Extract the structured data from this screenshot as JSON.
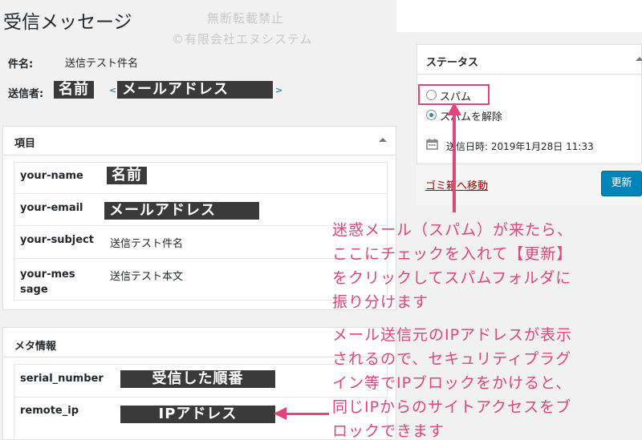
{
  "page": {
    "title": "受信メッセージ",
    "watermark_line1": "無断転載禁止",
    "watermark_line2": "©有限会社エヌシステム"
  },
  "header": {
    "subject_label": "件名:",
    "subject_value": "送信テスト件名",
    "sender_label": "送信者:",
    "sender_name_mask": "名前",
    "sender_email_mask": "メールアドレス",
    "bracket_open": "<",
    "bracket_close": ">"
  },
  "items_box": {
    "title": "項目",
    "rows": [
      {
        "key": "your-name",
        "value": "名前"
      },
      {
        "key": "your-email",
        "value": "メールアドレス"
      },
      {
        "key": "your-subject",
        "value": "送信テスト件名"
      },
      {
        "key": "your-message",
        "value": "送信テスト本文"
      }
    ]
  },
  "meta_box": {
    "title": "メタ情報",
    "rows": [
      {
        "key": "serial_number",
        "value": "受信した順番"
      },
      {
        "key": "remote_ip",
        "value": "IPアドレス"
      }
    ]
  },
  "status_box": {
    "title": "ステータス",
    "radio_spam": "スパム",
    "radio_unspam": "スパムを解除",
    "sent_date": "送信日時: 2019年1月28日 11:33",
    "trash_link": "ゴミ箱へ移動",
    "update_button": "更新"
  },
  "annotations": {
    "spam_note": [
      "迷惑メール（スパム）が来たら、",
      "ここにチェックを入れて【更新】",
      "をクリックしてスパムフォルダに",
      "振り分けます"
    ],
    "ip_note": [
      "メール送信元のIPアドレスが表示",
      "されるので、セキュリティプラグ",
      "イン等でIPブロックをかけると、",
      "同じIPからのサイトアクセスをブ",
      "ロックできます"
    ]
  },
  "colors": {
    "accent": "#0085ba",
    "annotation": "#e0457b",
    "mask": "#3a3a3a"
  }
}
